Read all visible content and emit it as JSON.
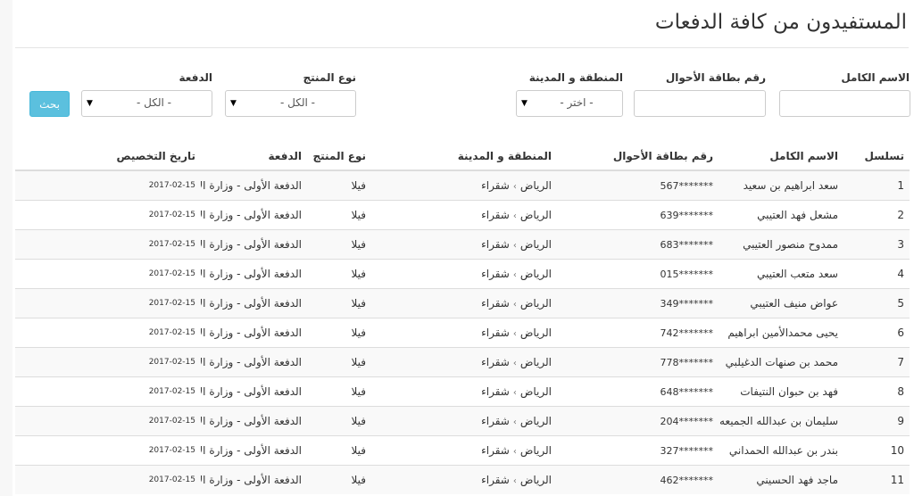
{
  "page": {
    "title": "المستفيدون من كافة الدفعات"
  },
  "filters": {
    "full_name_label": "الاسم الكامل",
    "id_card_label": "رقم بطاقة الأحوال",
    "region_label": "المنطقة و المدينة",
    "region_value": "- اختر -",
    "product_label": "نوع المنتج",
    "product_value": "- الكل -",
    "batch_label": "الدفعة",
    "batch_value": "- الكل -",
    "search_label": "بحث"
  },
  "table": {
    "headers": {
      "serial": "تسلسل",
      "full_name": "الاسم الكامل",
      "id_card": "رقم بطاقة الأحوال",
      "region": "المنطقة و المدينة",
      "product": "نوع المنتج",
      "batch": "الدفعة",
      "date": "تاريخ التخصيص"
    },
    "rows": [
      {
        "serial": "1",
        "name": "سعد ابراهيم بن سعيد",
        "card": "567*******",
        "region": "الرياض",
        "city": "شقراء",
        "product": "فيلا",
        "batch": "الدفعة الأولى - وزارة الإسكان",
        "date": "2017-02-15"
      },
      {
        "serial": "2",
        "name": "مشعل فهد العتيبي",
        "card": "639*******",
        "region": "الرياض",
        "city": "شقراء",
        "product": "فيلا",
        "batch": "الدفعة الأولى - وزارة الإسكان",
        "date": "2017-02-15"
      },
      {
        "serial": "3",
        "name": "ممدوح منصور العتيبي",
        "card": "683*******",
        "region": "الرياض",
        "city": "شقراء",
        "product": "فيلا",
        "batch": "الدفعة الأولى - وزارة الإسكان",
        "date": "2017-02-15"
      },
      {
        "serial": "4",
        "name": "سعد متعب العتيبي",
        "card": "015*******",
        "region": "الرياض",
        "city": "شقراء",
        "product": "فيلا",
        "batch": "الدفعة الأولى - وزارة الإسكان",
        "date": "2017-02-15"
      },
      {
        "serial": "5",
        "name": "عواض منيف العتيبي",
        "card": "349*******",
        "region": "الرياض",
        "city": "شقراء",
        "product": "فيلا",
        "batch": "الدفعة الأولى - وزارة الإسكان",
        "date": "2017-02-15"
      },
      {
        "serial": "6",
        "name": "يحيى محمدالأمين ابراهيم",
        "card": "742*******",
        "region": "الرياض",
        "city": "شقراء",
        "product": "فيلا",
        "batch": "الدفعة الأولى - وزارة الإسكان",
        "date": "2017-02-15"
      },
      {
        "serial": "7",
        "name": "محمد بن صنهات الدغيلبي",
        "card": "778*******",
        "region": "الرياض",
        "city": "شقراء",
        "product": "فيلا",
        "batch": "الدفعة الأولى - وزارة الإسكان",
        "date": "2017-02-15"
      },
      {
        "serial": "8",
        "name": "فهد بن حبوان النتيفات",
        "card": "648*******",
        "region": "الرياض",
        "city": "شقراء",
        "product": "فيلا",
        "batch": "الدفعة الأولى - وزارة الإسكان",
        "date": "2017-02-15"
      },
      {
        "serial": "9",
        "name": "سليمان بن عبدالله الجميعه",
        "card": "204*******",
        "region": "الرياض",
        "city": "شقراء",
        "product": "فيلا",
        "batch": "الدفعة الأولى - وزارة الإسكان",
        "date": "2017-02-15"
      },
      {
        "serial": "10",
        "name": "بندر بن عبدالله الحمداني",
        "card": "327*******",
        "region": "الرياض",
        "city": "شقراء",
        "product": "فيلا",
        "batch": "الدفعة الأولى - وزارة الإسكان",
        "date": "2017-02-15"
      },
      {
        "serial": "11",
        "name": "ماجد فهد الحسيني",
        "card": "462*******",
        "region": "الرياض",
        "city": "شقراء",
        "product": "فيلا",
        "batch": "الدفعة الأولى - وزارة الإسكان",
        "date": "2017-02-15"
      }
    ]
  },
  "icons": {
    "select_caret": "caret-down-icon",
    "city_separator": "chevron-left-icon"
  },
  "colors": {
    "search_button": "#5bc0de",
    "stripe": "#f9f9f9",
    "border": "#dddddd"
  }
}
